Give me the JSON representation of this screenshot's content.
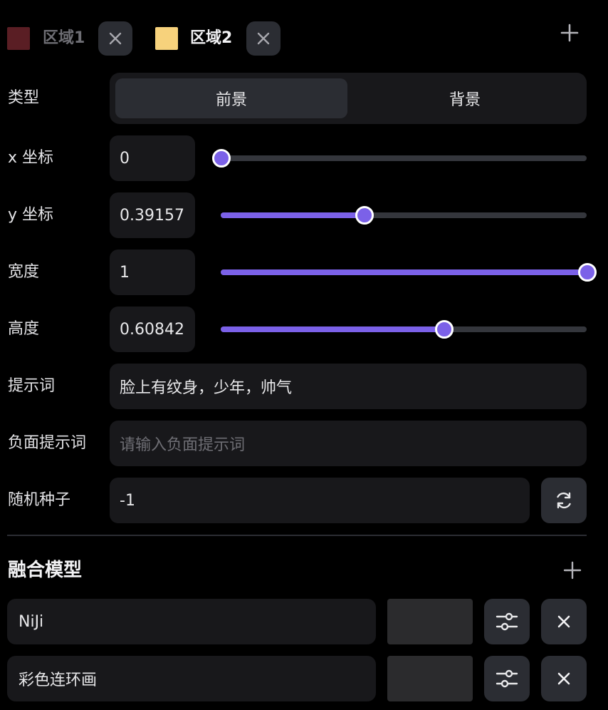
{
  "regions": [
    {
      "label": "区域1",
      "color": "#5a1e24",
      "active": false
    },
    {
      "label": "区域2",
      "color": "#f7d27c",
      "active": true
    }
  ],
  "form": {
    "type_label": "类型",
    "type_options": [
      "前景",
      "背景"
    ],
    "type_selected": "前景",
    "x": {
      "label": "x 坐标",
      "value": "0",
      "fraction": 0
    },
    "y": {
      "label": "y 坐标",
      "value": "0.39157",
      "fraction": 0.39157
    },
    "width": {
      "label": "宽度",
      "value": "1",
      "fraction": 1
    },
    "height": {
      "label": "高度",
      "value": "0.60842",
      "fraction": 0.60842
    },
    "prompt": {
      "label": "提示词",
      "value": "脸上有纹身，少年，帅气"
    },
    "negative_prompt": {
      "label": "负面提示词",
      "value": "",
      "placeholder": "请输入负面提示词"
    },
    "seed": {
      "label": "随机种子",
      "value": "-1"
    }
  },
  "models_section": {
    "title": "融合模型",
    "items": [
      {
        "name": "NiJi"
      },
      {
        "name": "彩色连环画"
      }
    ]
  },
  "colors": {
    "accent": "#7b61e8",
    "panel": "#18181b",
    "button": "#2b2d33"
  },
  "icons": {
    "add": "plus-icon",
    "close": "close-icon",
    "refresh": "refresh-icon",
    "settings": "sliders-icon"
  }
}
